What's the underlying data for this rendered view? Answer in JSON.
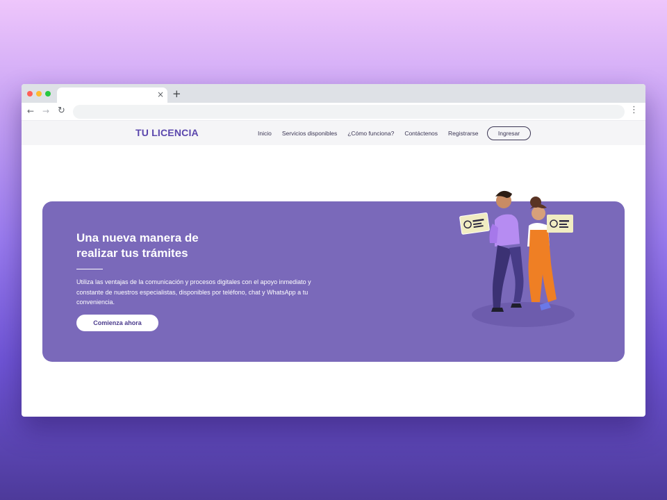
{
  "browser": {
    "tab": {
      "title": "",
      "close_glyph": "×"
    },
    "new_tab_glyph": "+",
    "toolbar": {
      "back_glyph": "←",
      "forward_glyph": "→",
      "reload_glyph": "↻",
      "address": "",
      "menu_glyph": "⋮"
    }
  },
  "site": {
    "logo": "TU LICENCIA",
    "nav": {
      "items": [
        {
          "label": "Inicio"
        },
        {
          "label": "Servicios disponibles"
        },
        {
          "label": "¿Cómo funciona?"
        },
        {
          "label": "Contáctenos"
        },
        {
          "label": "Registrarse"
        }
      ],
      "login_label": "Ingresar"
    },
    "hero": {
      "title_line1": "Una nueva manera de",
      "title_line2": "realizar tus trámites",
      "description": "Utiliza las ventajas de la comunicación y procesos digitales con el apoyo inmediato y constante de nuestros especialistas, disponibles por teléfono, chat y WhatsApp a tu conveniencia.",
      "cta_label": "Comienza ahora"
    }
  },
  "colors": {
    "brand": "#5b47ad",
    "hero_bg": "#7a69ba",
    "page_bg_top": "#eec6fb",
    "page_bg_bottom": "#4d3a9a"
  },
  "icons": [
    "close-icon",
    "plus-icon",
    "back-arrow-icon",
    "forward-arrow-icon",
    "reload-icon",
    "menu-dots-icon",
    "id-card-icon"
  ]
}
